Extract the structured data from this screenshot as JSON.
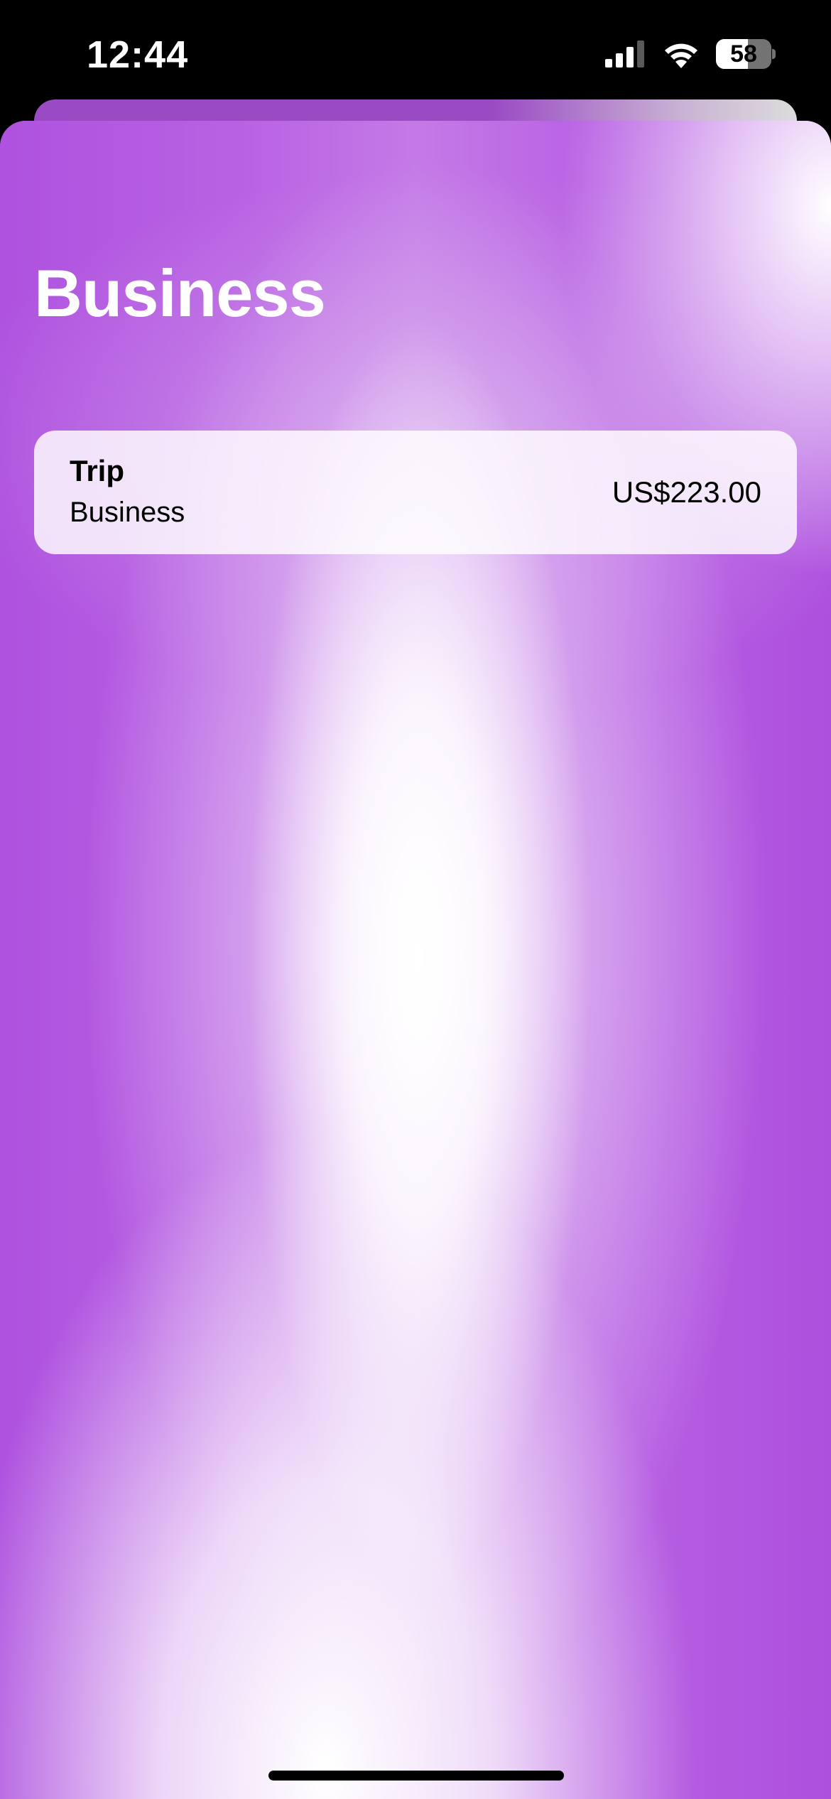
{
  "status_bar": {
    "time": "12:44",
    "battery_percent": "58",
    "battery_level": 0.58,
    "icons": [
      "cellular-signal-icon",
      "wifi-icon",
      "battery-icon"
    ]
  },
  "page": {
    "title": "Business"
  },
  "trips": [
    {
      "title": "Trip",
      "category": "Business",
      "amount": "US$223.00"
    }
  ],
  "colors": {
    "accent_purple": "#b055e0",
    "status_bar_bg": "#000000",
    "row_bg": "#f5e9fb"
  }
}
